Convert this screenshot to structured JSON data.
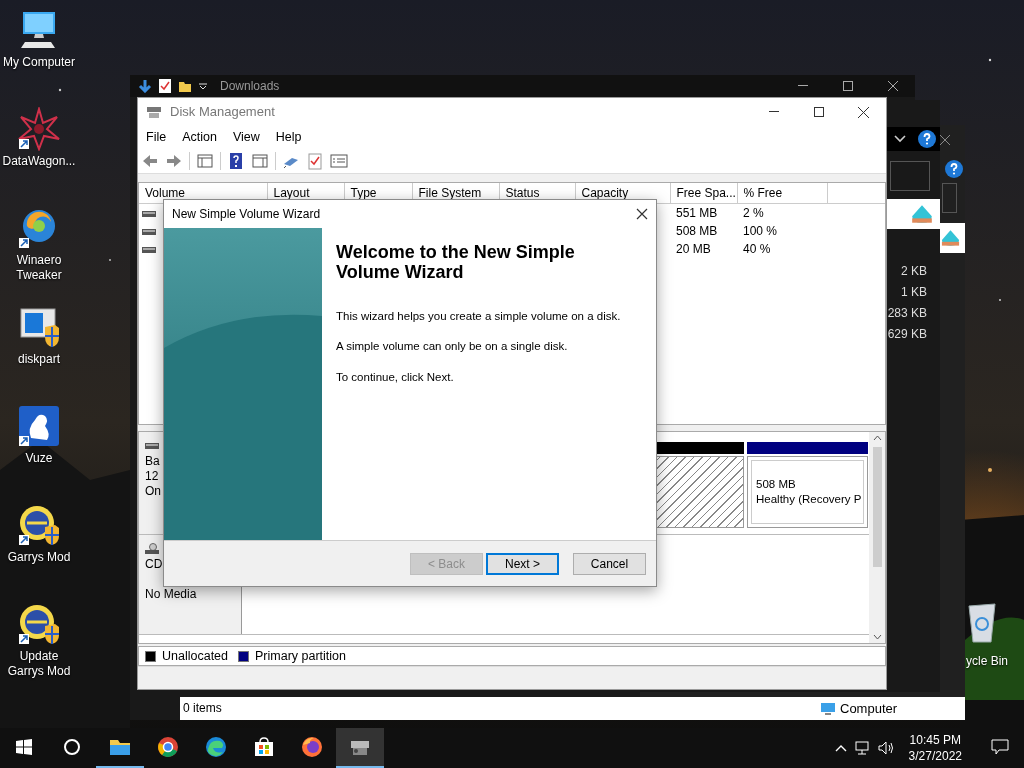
{
  "desktop": {
    "icons": [
      {
        "label": "My Computer"
      },
      {
        "label": "DataWagon..."
      },
      {
        "label": "Winaero Tweaker"
      },
      {
        "label": "diskpart"
      },
      {
        "label": "Vuze"
      },
      {
        "label": "Garrys Mod"
      },
      {
        "label": "Update Garrys Mod"
      }
    ],
    "recycle_bin": {
      "label": "ycle Bin"
    }
  },
  "explorer": {
    "title": "Downloads",
    "status": "0 items"
  },
  "side_window": {
    "sizes": [
      "2 KB",
      "1 KB",
      "283 KB",
      "629 KB"
    ]
  },
  "back_window": {
    "status": "Computer"
  },
  "disk_management": {
    "title": "Disk Management",
    "menu": [
      "File",
      "Action",
      "View",
      "Help"
    ],
    "columns": [
      "Volume",
      "Layout",
      "Type",
      "File System",
      "Status",
      "Capacity",
      "Free Spa...",
      "% Free"
    ],
    "rows": [
      {
        "free_space": "551 MB",
        "percent_free": "2 %"
      },
      {
        "free_space": "508 MB",
        "percent_free": "100 %"
      },
      {
        "free_space": "20 MB",
        "percent_free": "40 %"
      }
    ],
    "disks": [
      {
        "kind": "disk",
        "info": [
          "Ba",
          "12",
          "On"
        ],
        "partitions": [
          {
            "kind": "unallocated",
            "color": "#000000"
          },
          {
            "kind": "primary",
            "color": "#000080",
            "size": "508 MB",
            "status": "Healthy (Recovery P"
          }
        ]
      },
      {
        "kind": "cdrom",
        "info": [
          "CD"
        ],
        "media": "No Media"
      }
    ],
    "legend": [
      {
        "label": "Unallocated",
        "color": "#000000"
      },
      {
        "label": "Primary partition",
        "color": "#000080"
      }
    ]
  },
  "wizard": {
    "title": "New Simple Volume Wizard",
    "heading": "Welcome to the New Simple Volume Wizard",
    "paragraphs": [
      "This wizard helps you create a simple volume on a disk.",
      "A simple volume can only be on a single disk.",
      "To continue, click Next."
    ],
    "buttons": [
      {
        "label": "< Back",
        "disabled": true,
        "focused": false
      },
      {
        "label": "Next >",
        "disabled": false,
        "focused": true
      },
      {
        "label": "Cancel",
        "disabled": false,
        "focused": false
      }
    ]
  },
  "taskbar": {
    "apps": [
      {
        "running": true,
        "active": false
      },
      {
        "running": false,
        "active": false
      },
      {
        "running": false,
        "active": false
      },
      {
        "running": false,
        "active": false
      },
      {
        "running": false,
        "active": false
      },
      {
        "running": true,
        "active": true
      }
    ],
    "time": "10:45 PM",
    "date": "3/27/2022"
  }
}
